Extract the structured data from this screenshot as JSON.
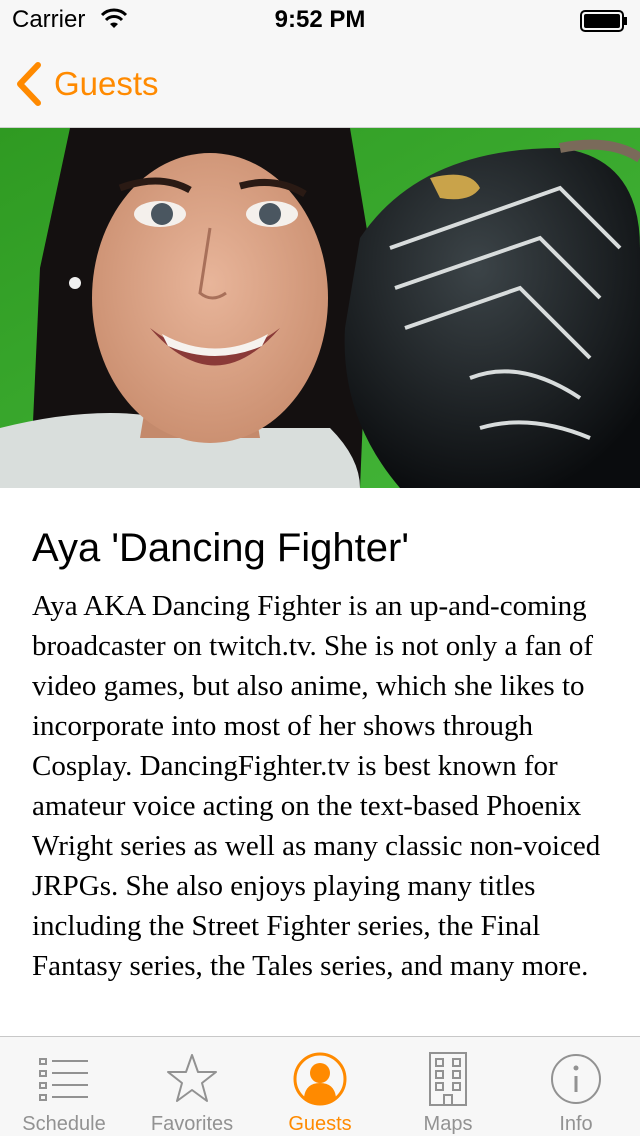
{
  "status_bar": {
    "carrier": "Carrier",
    "time": "9:52 PM"
  },
  "nav": {
    "back_label": "Guests"
  },
  "guest": {
    "name": "Aya 'Dancing Fighter'",
    "bio": "Aya AKA Dancing Fighter is an up-and-coming broadcaster on twitch.tv. She is not only a fan of video games, but also anime, which she likes to incorporate into most of her shows through Cosplay. DancingFighter.tv is best known for amateur voice acting on the text-based Phoenix Wright series as well as many classic non-voiced JRPGs. She also enjoys playing many titles including the Street Fighter series, the Final Fantasy series, the Tales series, and many more."
  },
  "tabs": [
    {
      "label": "Schedule",
      "icon": "list-icon"
    },
    {
      "label": "Favorites",
      "icon": "star-icon"
    },
    {
      "label": "Guests",
      "icon": "person-icon"
    },
    {
      "label": "Maps",
      "icon": "building-icon"
    },
    {
      "label": "Info",
      "icon": "info-icon"
    }
  ],
  "colors": {
    "accent": "#ff8a00",
    "inactive": "#929292",
    "bar": "#f7f7f7"
  }
}
